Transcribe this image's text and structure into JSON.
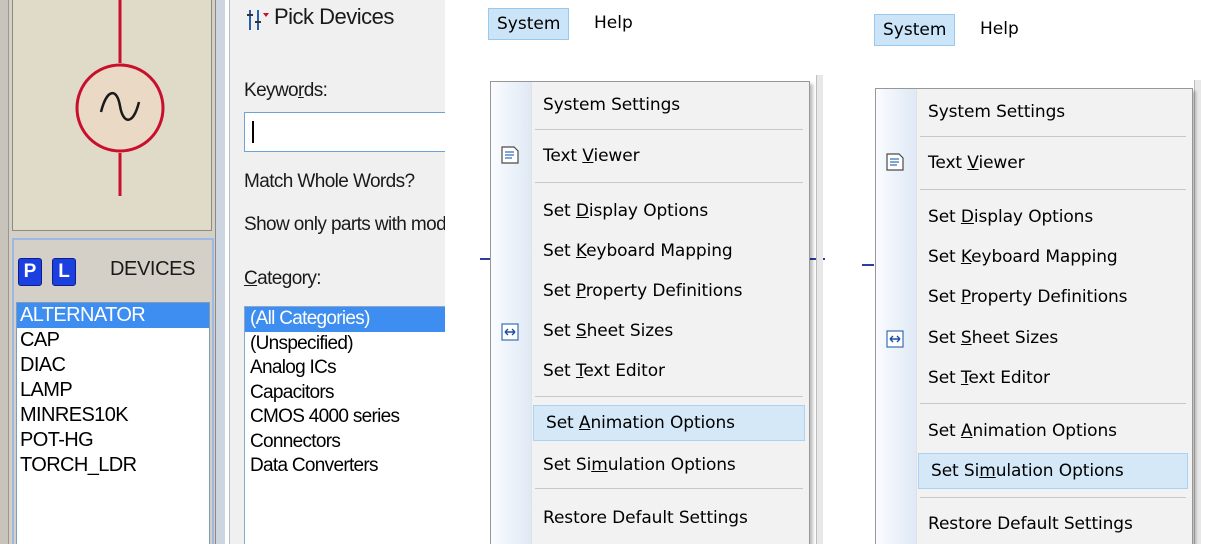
{
  "devices_panel": {
    "header_buttons": [
      "P",
      "L"
    ],
    "title": "DEVICES",
    "items": [
      "ALTERNATOR",
      "CAP",
      "DIAC",
      "LAMP",
      "MINRES10K",
      "POT-HG",
      "TORCH_LDR"
    ],
    "selected_index": 0
  },
  "pick_devices": {
    "title": "Pick Devices",
    "keywords_label": "Keywords:",
    "keywords_value": "",
    "match_whole_words": "Match Whole Words?",
    "show_only_parts": "Show only parts with mode",
    "category_label": "Category:",
    "categories": [
      "(All Categories)",
      "(Unspecified)",
      "Analog ICs",
      "Capacitors",
      "CMOS 4000 series",
      "Connectors",
      "Data Converters"
    ],
    "selected_index": 0
  },
  "menu_a": {
    "menubar": [
      "System",
      "Help"
    ],
    "highlighted": "Set Animation Options"
  },
  "menu_b": {
    "menubar": [
      "System",
      "Help"
    ],
    "highlighted": "Set Simulation Options"
  },
  "system_menu_items": {
    "system_settings": "System Settings",
    "text_viewer": "Text Viewer",
    "set_display_options": "Set Display Options",
    "set_keyboard_mapping": "Set Keyboard Mapping",
    "set_property_definitions": "Set Property Definitions",
    "set_sheet_sizes": "Set Sheet Sizes",
    "set_text_editor": "Set Text Editor",
    "set_animation_options": "Set Animation Options",
    "set_simulation_options": "Set Simulation Options",
    "restore_default_settings": "Restore Default Settings"
  },
  "colors": {
    "selection": "#3d8ef0",
    "menu_highlight": "#d5e8f8",
    "device_buttons": "#1c3fe0",
    "symbol_red": "#c8102e"
  }
}
